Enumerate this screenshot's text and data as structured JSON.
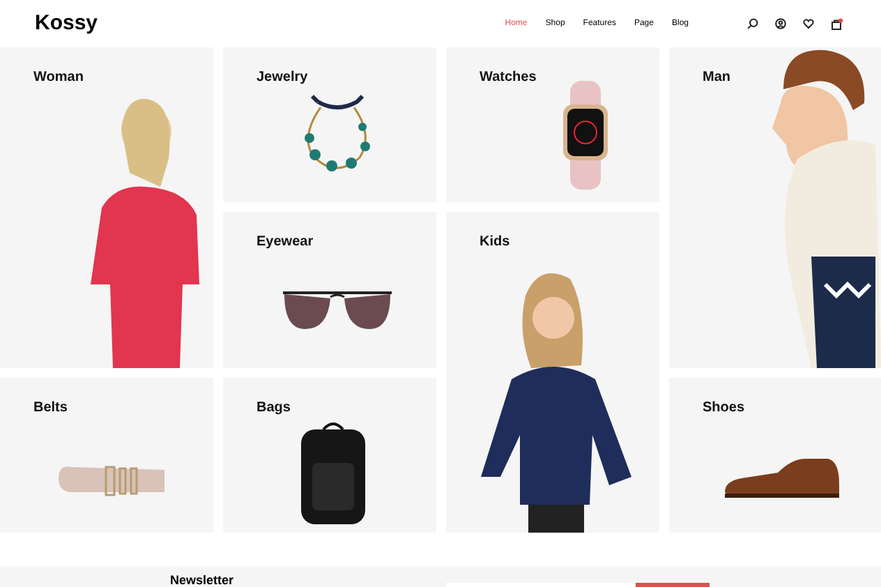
{
  "brand": "Kossy",
  "nav": [
    {
      "label": "Home",
      "selected": true
    },
    {
      "label": "Shop",
      "selected": false
    },
    {
      "label": "Features",
      "selected": false
    },
    {
      "label": "Page",
      "selected": false
    },
    {
      "label": "Blog",
      "selected": false
    }
  ],
  "categories": [
    {
      "label": "Woman",
      "kind": "woman"
    },
    {
      "label": "Jewelry",
      "kind": "jewelry"
    },
    {
      "label": "Watches",
      "kind": "watch"
    },
    {
      "label": "Man",
      "kind": "man"
    },
    {
      "label": "Eyewear",
      "kind": "eyewear"
    },
    {
      "label": "Kids",
      "kind": "kids"
    },
    {
      "label": "Belts",
      "kind": "belt"
    },
    {
      "label": "Bags",
      "kind": "bag"
    },
    {
      "label": "Shoes",
      "kind": "shoe"
    }
  ],
  "newsletter": {
    "title": "Newsletter"
  }
}
